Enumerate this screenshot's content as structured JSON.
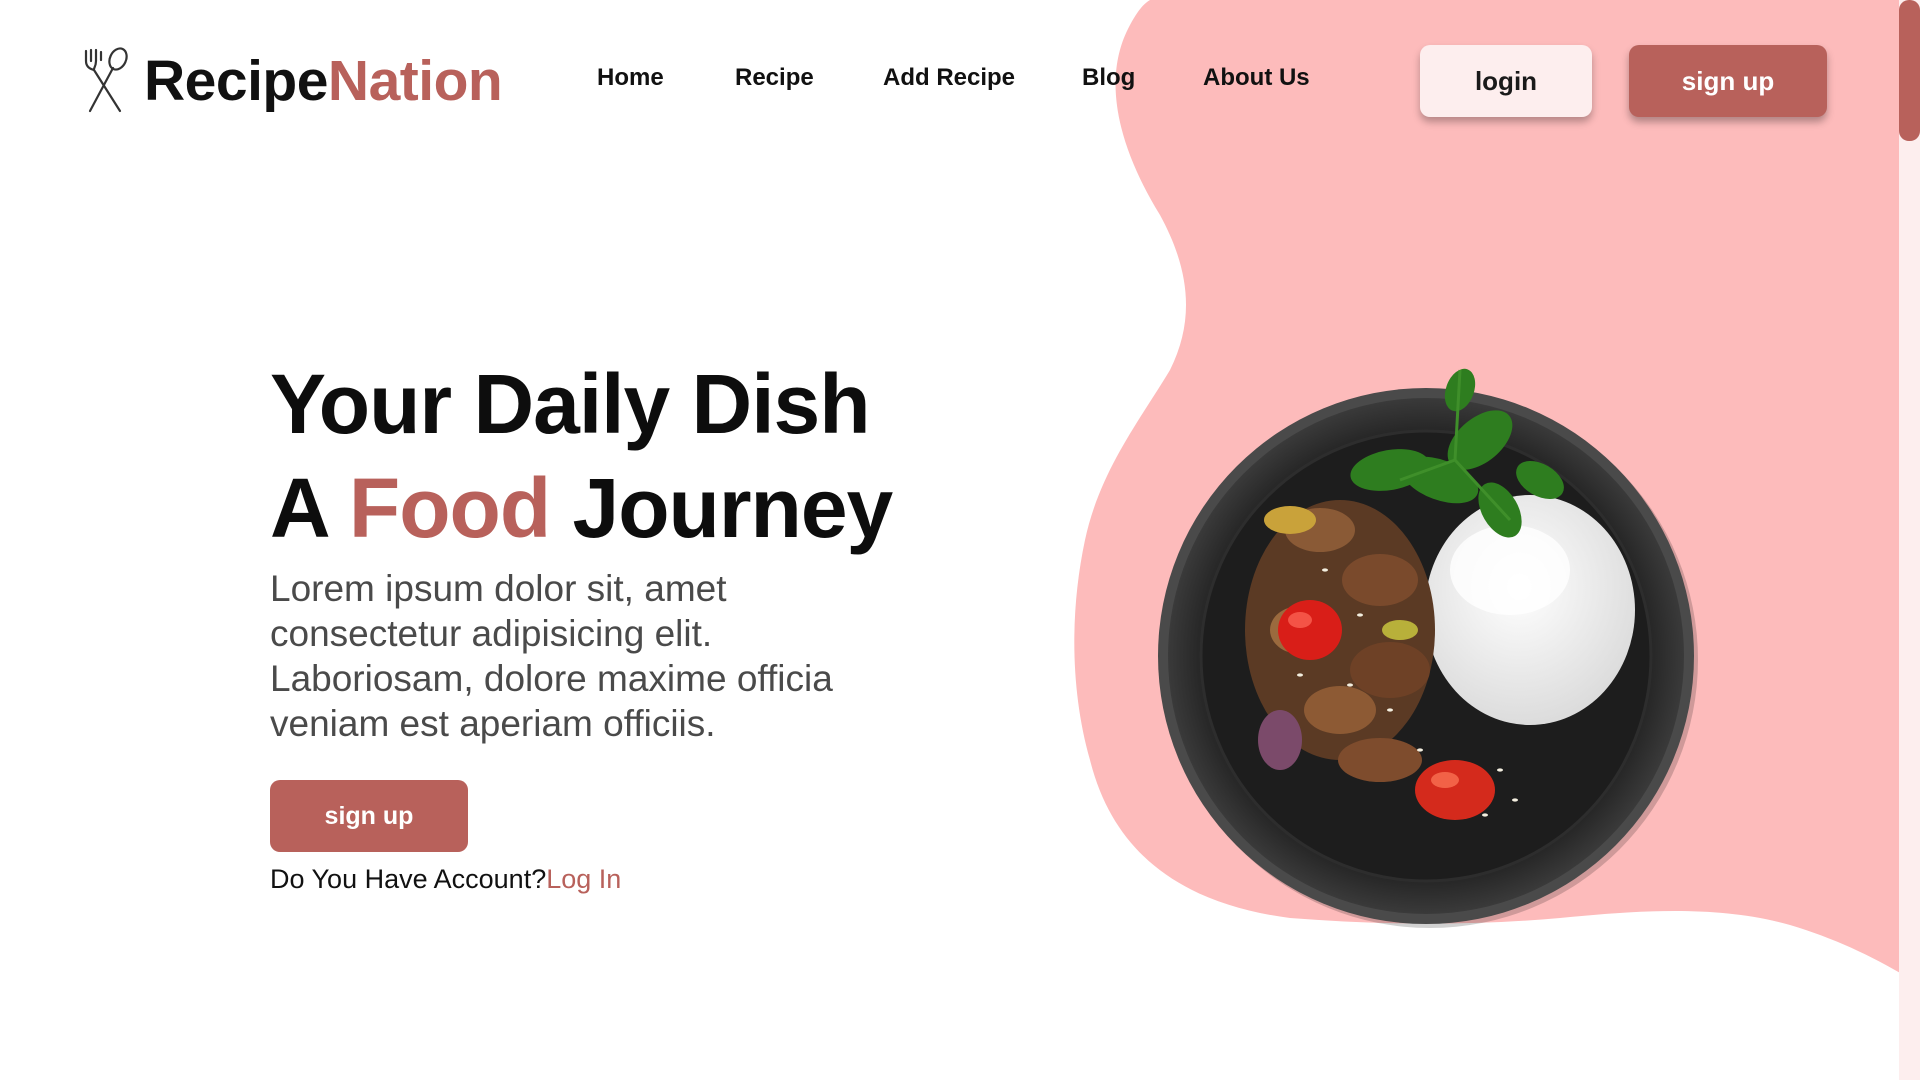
{
  "brand": {
    "name_part1": "Recipe",
    "name_part2": "Nation",
    "icon": "fork-and-spoon-icon"
  },
  "nav": {
    "items": [
      {
        "label": "Home"
      },
      {
        "label": "Recipe"
      },
      {
        "label": "Add Recipe"
      },
      {
        "label": "Blog"
      },
      {
        "label": "About Us"
      }
    ]
  },
  "header": {
    "login_label": "login",
    "signup_label": "sign up"
  },
  "hero": {
    "title_line1": "Your Daily Dish",
    "title_line2_before": "A",
    "title_line2_accent": "Food",
    "title_line2_after": "Journey",
    "description": "Lorem ipsum dolor sit, amet consectetur adipisicing elit. Laboriosam, dolore maxime officia veniam est aperiam officiis.",
    "signup_label": "sign up",
    "account_question": "Do You Have Account?",
    "account_link": "Log In"
  },
  "colors": {
    "accent": "#b8615b",
    "blob": "#fdbbbb",
    "light_button": "#fdeeee",
    "text": "#111111"
  }
}
